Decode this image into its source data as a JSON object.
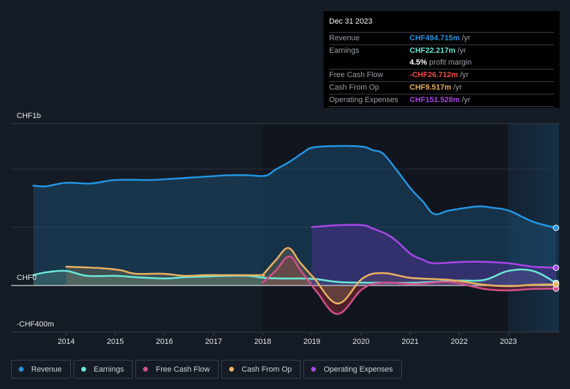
{
  "tooltip": {
    "date": "Dec 31 2023",
    "rows": [
      {
        "label": "Revenue",
        "value": "CHF494.715m",
        "unit": "/yr",
        "color": "#2394e0"
      },
      {
        "label": "Earnings",
        "value": "CHF22.217m",
        "unit": "/yr",
        "color": "#6ce5d4"
      },
      {
        "label": "",
        "value": "4.5%",
        "unit": "profit margin",
        "color": "#ffffff"
      },
      {
        "label": "Free Cash Flow",
        "value": "-CHF26.712m",
        "unit": "/yr",
        "color": "#ef4b4b"
      },
      {
        "label": "Cash From Op",
        "value": "CHF9.517m",
        "unit": "/yr",
        "color": "#e8b160"
      },
      {
        "label": "Operating Expenses",
        "value": "CHF151.528m",
        "unit": "/yr",
        "color": "#a646e6"
      }
    ]
  },
  "legend": [
    {
      "label": "Revenue",
      "color": "#2394e0"
    },
    {
      "label": "Earnings",
      "color": "#6ce5d4"
    },
    {
      "label": "Free Cash Flow",
      "color": "#d2508a"
    },
    {
      "label": "Cash From Op",
      "color": "#e8b160"
    },
    {
      "label": "Operating Expenses",
      "color": "#a646e6"
    }
  ],
  "chart_data": {
    "type": "area",
    "title": "",
    "xlabel": "",
    "ylabel": "",
    "y_axis_labels": {
      "top": "CHF1b",
      "zero": "CHF0",
      "bottom": "-CHF400m"
    },
    "ylim": [
      -400,
      1390
    ],
    "y_gridlines": [
      0,
      500,
      1000
    ],
    "xlim": [
      2013.33,
      2024.0
    ],
    "x_ticks": [
      "2014",
      "2015",
      "2016",
      "2017",
      "2018",
      "2019",
      "2020",
      "2021",
      "2022",
      "2023"
    ],
    "highlight_region": [
      2023.0,
      2024.0
    ],
    "units": "CHF millions",
    "series": [
      {
        "name": "Revenue",
        "color": "#2394e0",
        "fill": true,
        "x": [
          2013.33,
          2013.59,
          2014.0,
          2014.5,
          2015.0,
          2015.7,
          2016.0,
          2016.85,
          2017.3,
          2017.7,
          2018.05,
          2018.26,
          2018.54,
          2018.83,
          2019.03,
          2019.53,
          2020.03,
          2020.24,
          2020.45,
          2020.74,
          2021.02,
          2021.26,
          2021.49,
          2021.8,
          2022.37,
          2022.66,
          2023.0,
          2023.5,
          2023.97
        ],
        "values": [
          858,
          852,
          882,
          876,
          906,
          906,
          912,
          935,
          947,
          947,
          942,
          995,
          1061,
          1144,
          1186,
          1198,
          1192,
          1162,
          1132,
          983,
          828,
          721,
          614,
          644,
          679,
          668,
          644,
          548,
          495
        ]
      },
      {
        "name": "Earnings",
        "color": "#6ce5d4",
        "fill": true,
        "x": [
          2013.33,
          2013.59,
          2014.0,
          2014.42,
          2015.0,
          2015.42,
          2016.0,
          2016.42,
          2016.85,
          2017.28,
          2017.7,
          2018.05,
          2018.4,
          2018.83,
          2019.11,
          2019.53,
          2020.03,
          2020.45,
          2021.09,
          2021.94,
          2022.51,
          2023.0,
          2023.5,
          2023.97
        ],
        "values": [
          89,
          113,
          125,
          83,
          83,
          71,
          60,
          71,
          77,
          83,
          83,
          65,
          60,
          60,
          54,
          30,
          24,
          24,
          24,
          42,
          48,
          125,
          125,
          22
        ]
      },
      {
        "name": "Free Cash Flow",
        "color": "#d2508a",
        "fill": true,
        "x": [
          2018.0,
          2018.26,
          2018.54,
          2018.78,
          2019.1,
          2019.53,
          2020.03,
          2020.45,
          2021.09,
          2021.8,
          2022.51,
          2023.0,
          2023.5,
          2023.97
        ],
        "values": [
          24,
          125,
          250,
          125,
          -54,
          -245,
          -30,
          24,
          12,
          30,
          -30,
          -42,
          -30,
          -27
        ]
      },
      {
        "name": "Cash From Op",
        "color": "#e8b160",
        "fill": true,
        "x": [
          2014.0,
          2014.7,
          2015.11,
          2015.4,
          2015.97,
          2016.4,
          2016.85,
          2017.28,
          2017.97,
          2018.01,
          2018.26,
          2018.52,
          2018.76,
          2019.04,
          2019.53,
          2020.03,
          2020.45,
          2021.02,
          2021.8,
          2022.51,
          2023.0,
          2023.5,
          2023.97
        ],
        "values": [
          161,
          149,
          131,
          101,
          101,
          83,
          89,
          89,
          89,
          95,
          215,
          322,
          197,
          65,
          -155,
          60,
          107,
          65,
          48,
          6,
          -6,
          6,
          10
        ]
      },
      {
        "name": "Operating Expenses",
        "color": "#a646e6",
        "fill": true,
        "x": [
          2019.0,
          2019.53,
          2020.03,
          2020.24,
          2020.52,
          2020.74,
          2021.02,
          2021.26,
          2021.49,
          2022.08,
          2022.51,
          2023.0,
          2023.5,
          2023.97
        ],
        "values": [
          501,
          518,
          518,
          489,
          441,
          376,
          268,
          221,
          191,
          203,
          203,
          191,
          161,
          152
        ]
      }
    ]
  }
}
